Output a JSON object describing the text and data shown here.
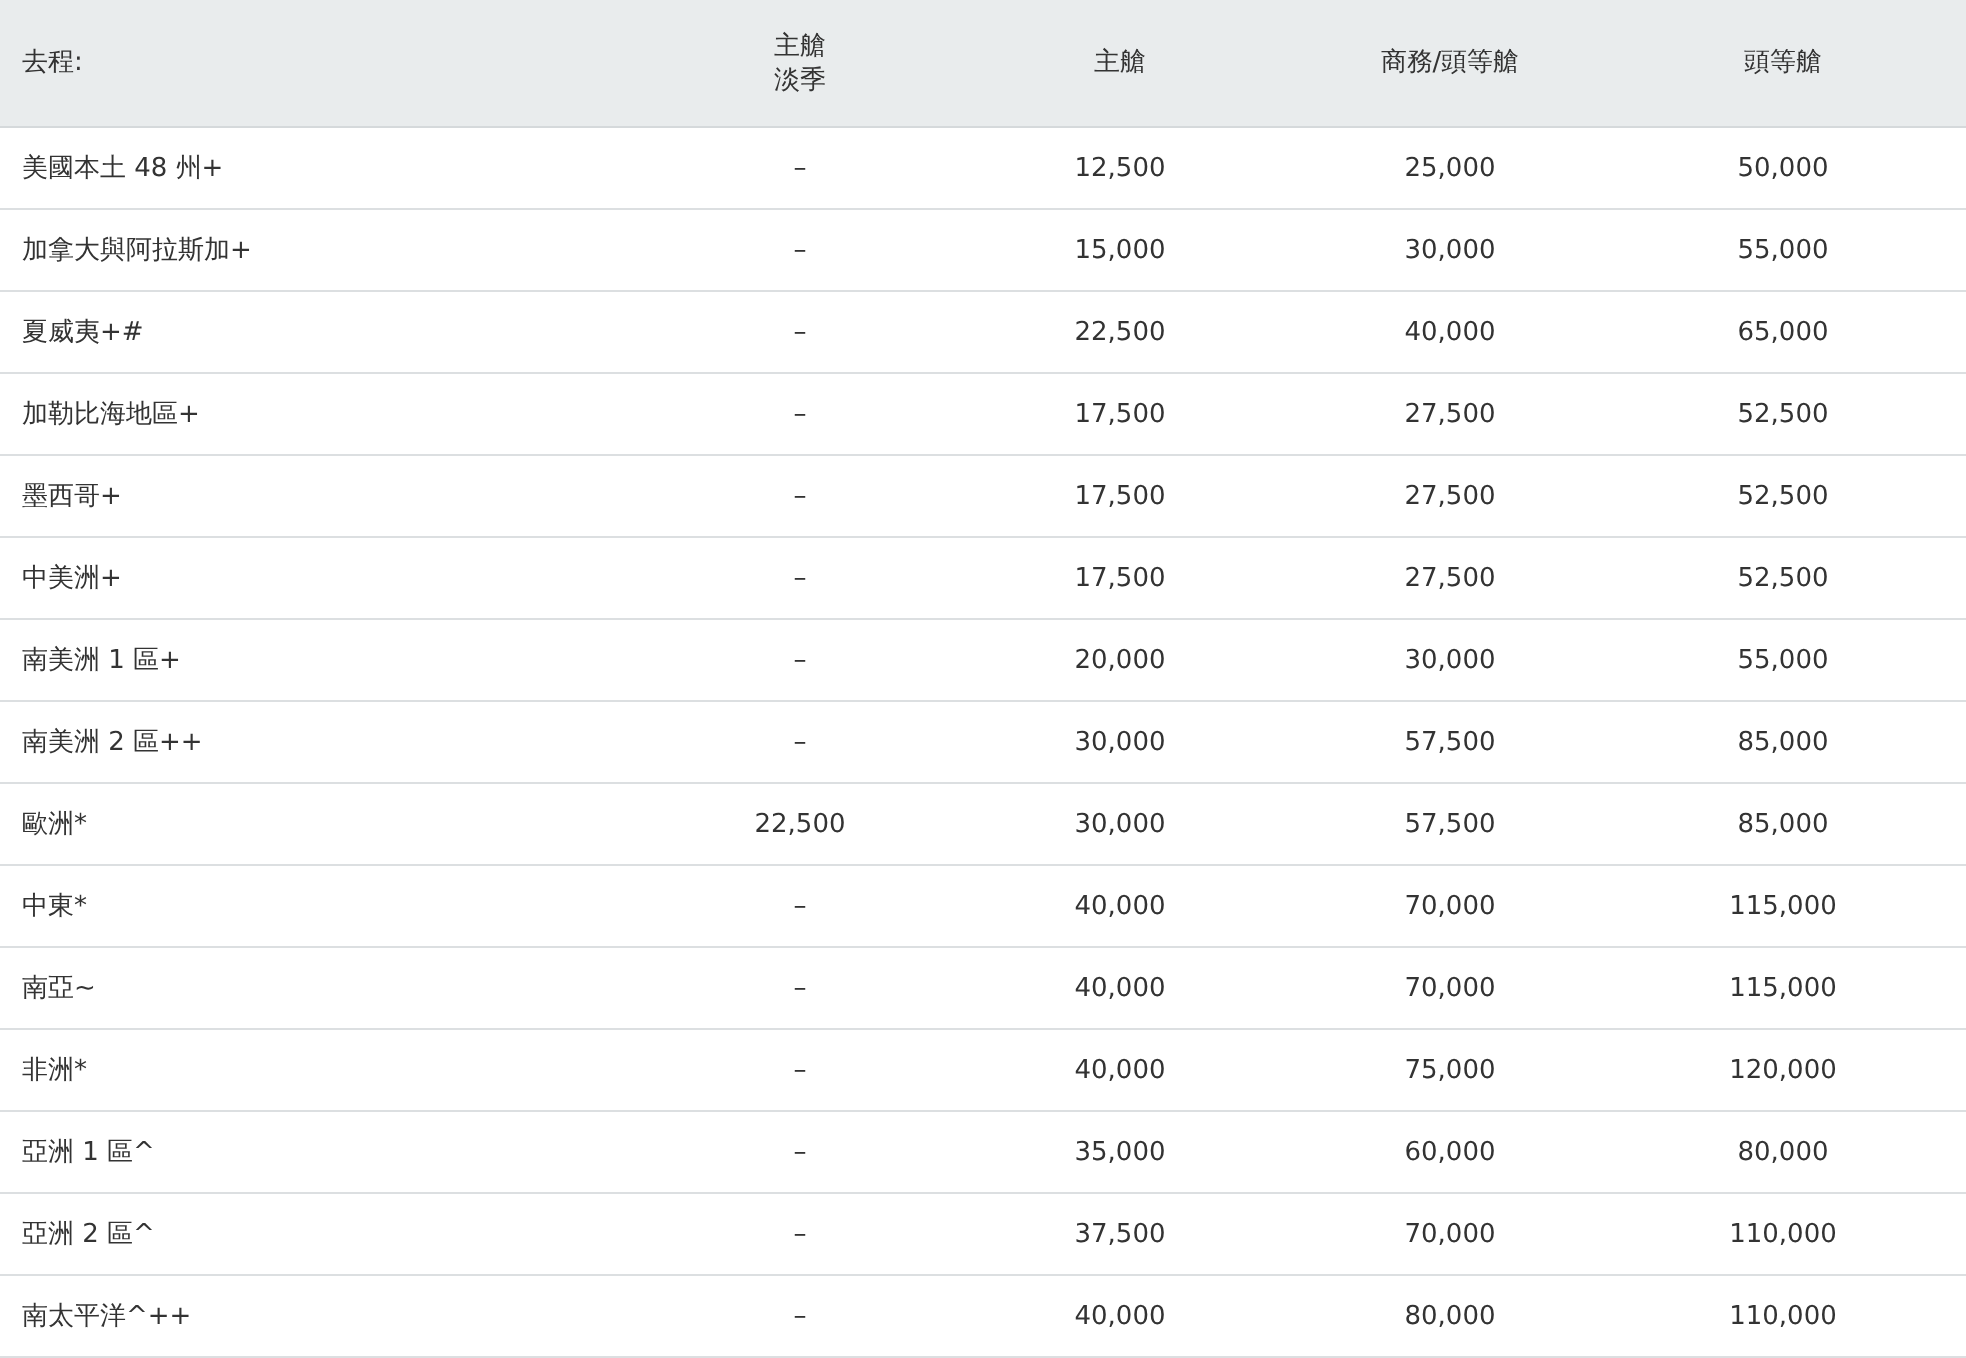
{
  "table": {
    "columns": [
      "去程:",
      "主艙淡季",
      "主艙",
      "商務/頭等艙",
      "頭等艙"
    ],
    "rows": [
      [
        "美國本土 48 州+",
        "–",
        "12,500",
        "25,000",
        "50,000"
      ],
      [
        "加拿大與阿拉斯加+",
        "–",
        "15,000",
        "30,000",
        "55,000"
      ],
      [
        "夏威夷+#",
        "–",
        "22,500",
        "40,000",
        "65,000"
      ],
      [
        "加勒比海地區+",
        "–",
        "17,500",
        "27,500",
        "52,500"
      ],
      [
        "墨西哥+",
        "–",
        "17,500",
        "27,500",
        "52,500"
      ],
      [
        "中美洲+",
        "–",
        "17,500",
        "27,500",
        "52,500"
      ],
      [
        "南美洲 1 區+",
        "–",
        "20,000",
        "30,000",
        "55,000"
      ],
      [
        "南美洲 2 區++",
        "–",
        "30,000",
        "57,500",
        "85,000"
      ],
      [
        "歐洲*",
        "22,500",
        "30,000",
        "57,500",
        "85,000"
      ],
      [
        "中東*",
        "–",
        "40,000",
        "70,000",
        "115,000"
      ],
      [
        "南亞~",
        "–",
        "40,000",
        "70,000",
        "115,000"
      ],
      [
        "非洲*",
        "–",
        "40,000",
        "75,000",
        "120,000"
      ],
      [
        "亞洲 1 區^",
        "–",
        "35,000",
        "60,000",
        "80,000"
      ],
      [
        "亞洲 2 區^",
        "–",
        "37,500",
        "70,000",
        "110,000"
      ],
      [
        "南太平洋^++",
        "–",
        "40,000",
        "80,000",
        "110,000"
      ]
    ]
  }
}
